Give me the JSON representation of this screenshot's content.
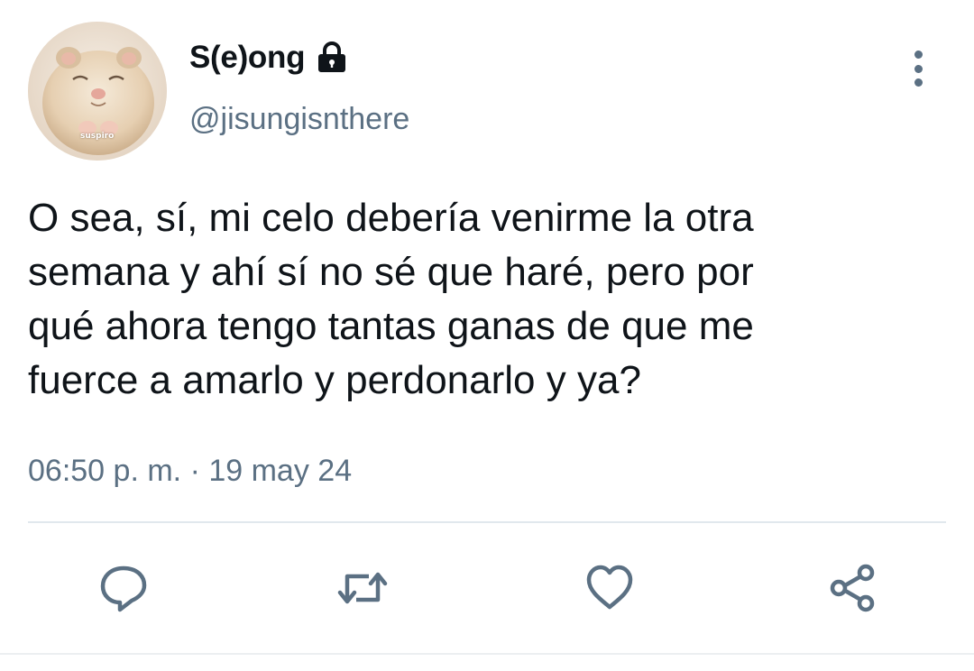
{
  "user": {
    "display_name": "S(e)ong",
    "handle": "@jisungisnthere",
    "avatar_caption": "suspiro",
    "protected_icon": "lock-icon"
  },
  "tweet": {
    "text_lines": [
      "O sea, sí, mi celo debería venirme la otra",
      "semana y ahí sí no sé que haré, pero por",
      "qué ahora tengo tantas ganas de que me",
      "fuerce a amarlo y perdonarlo y ya?"
    ],
    "time": "06:50 p. m.",
    "separator": "·",
    "date": "19 may 24"
  },
  "actions": [
    {
      "name": "reply",
      "icon": "reply-icon"
    },
    {
      "name": "retweet",
      "icon": "retweet-icon"
    },
    {
      "name": "like",
      "icon": "heart-icon"
    },
    {
      "name": "share",
      "icon": "share-icon"
    }
  ],
  "menu": {
    "icon": "more-vertical-icon"
  },
  "colors": {
    "text": "#0f1419",
    "secondary": "#5b7083",
    "divider": "#e1e8ed",
    "background": "#ffffff"
  }
}
